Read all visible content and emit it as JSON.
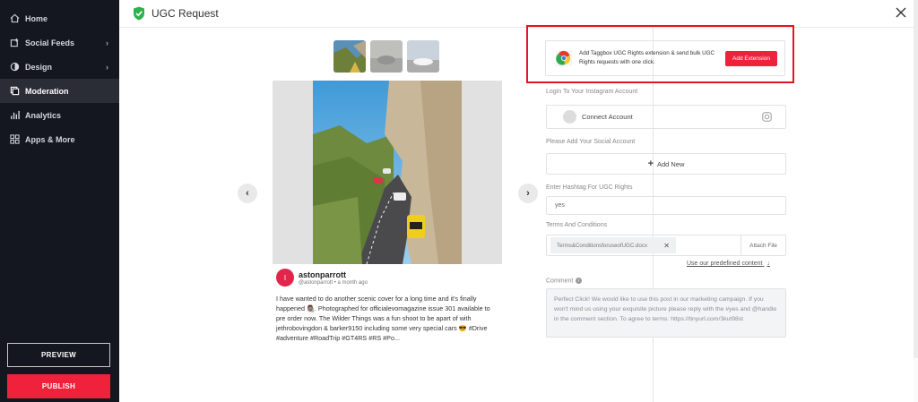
{
  "sidebar": {
    "items": [
      {
        "label": "Home",
        "icon": "home-icon",
        "has_chevron": false
      },
      {
        "label": "Social Feeds",
        "icon": "social-feeds-icon",
        "has_chevron": true
      },
      {
        "label": "Design",
        "icon": "palette-icon",
        "has_chevron": true
      },
      {
        "label": "Moderation",
        "icon": "moderation-icon",
        "has_chevron": false,
        "active": true
      },
      {
        "label": "Analytics",
        "icon": "analytics-icon",
        "has_chevron": false
      },
      {
        "label": "Apps & More",
        "icon": "apps-icon",
        "has_chevron": false
      }
    ],
    "preview_label": "PREVIEW",
    "publish_label": "PUBLISH"
  },
  "header": {
    "title": "UGC Request"
  },
  "post": {
    "author_initial": "I",
    "author_name": "astonparrott",
    "author_handle": "@astonparrott",
    "author_time": "a month ago",
    "caption": "I have wanted to do another scenic cover for a long time and it's finally happened 👩🏽‍🎨. Photographed for officialevomagazine issue 301 available to pre order now. The Wilder Things was a fun shoot to be apart of with jethrobovingdon & barker9150 including some very special cars 😎 #Drive #adventure #RoadTrip #GT4RS #RS #Po..."
  },
  "extension": {
    "text": "Add Taggbox UGC Rights extension & send bulk UGC Rights requests with one click.",
    "button_label": "Add Extension"
  },
  "form": {
    "instagram_label": "Login To Your Instagram Account",
    "connect_label": "Connect Account",
    "social_label": "Please Add Your Social Account",
    "add_new_label": "Add New",
    "hashtag_label": "Enter Hashtag For UGC Rights",
    "hashtag_value": "yes",
    "terms_label": "Terms And Conditions",
    "terms_file": "Terms&ConditionsforuseofUGC.docx",
    "attach_label": "Attach File",
    "predefined_link": "Use our predefined content",
    "comment_label": "Comment",
    "comment_value": "Perfect Click! We would like to use this post in our marketing campaign. If you won't mind us using your exquisite picture please reply with the #yes and @handle in the comment section. To agree to terms: https://tinyurl.com/3kut98st"
  },
  "colors": {
    "sidebar_bg": "#14171f",
    "accent_red": "#f0213a",
    "highlight_border": "#e8141d",
    "shield_green": "#2fb24c"
  }
}
